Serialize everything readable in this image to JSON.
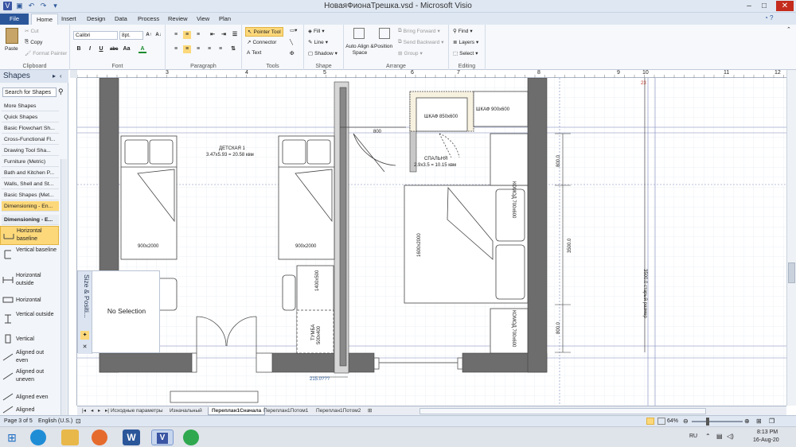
{
  "window": {
    "title": "НоваяФионаТрешка.vsd  -  Microsoft Visio"
  },
  "tabs": [
    "File",
    "Home",
    "Insert",
    "Design",
    "Data",
    "Process",
    "Review",
    "View",
    "Plan"
  ],
  "ribbon": {
    "clipboard": {
      "paste": "Paste",
      "cut": "Cut",
      "copy": "Copy",
      "format_painter": "Format Painter",
      "label": "Clipboard"
    },
    "font": {
      "family": "Calibri",
      "size": "8pt.",
      "label": "Font",
      "bold": "B",
      "italic": "I",
      "underline": "U",
      "abc": "abc",
      "aa": "Aa"
    },
    "paragraph": {
      "label": "Paragraph"
    },
    "tools": {
      "pointer": "Pointer Tool",
      "connector": "Connector",
      "text": "Text",
      "label": "Tools"
    },
    "shape": {
      "fill": "Fill",
      "line": "Line",
      "shadow": "Shadow",
      "label": "Shape"
    },
    "arrange": {
      "auto_align": "Auto Align & Space",
      "position": "Position",
      "bring_forward": "Bring Forward",
      "send_backward": "Send Backward",
      "group": "Group",
      "label": "Arrange"
    },
    "editing": {
      "find": "Find",
      "layers": "Layers",
      "select": "Select",
      "label": "Editing"
    }
  },
  "shapes_panel": {
    "title": "Shapes",
    "search_placeholder": "Search for Shapes",
    "stencils": [
      "More Shapes",
      "Quick Shapes",
      "Basic Flowchart Sh...",
      "Cross-Functional Fl...",
      "Drawing Tool Sha...",
      "Furniture (Metric)",
      "Bath and Kitchen P...",
      "Walls, Shell and St...",
      "Basic Shapes (Met...",
      "Dimensioning - En..."
    ],
    "open_stencil": "Dimensioning - E...",
    "masters": [
      "Horizontal baseline",
      "Vertical baseline",
      "Horizontal outside",
      "Horizontal",
      "Vertical outside",
      "Vertical",
      "Aligned out even",
      "Aligned out uneven",
      "Aligned even",
      "Aligned"
    ]
  },
  "size_position": {
    "title": "Size & Positi...",
    "message": "No Selection"
  },
  "drawing": {
    "ruler_numbers": [
      "3",
      "4",
      "5",
      "6",
      "7",
      "8",
      "9",
      "10",
      "11",
      "12"
    ],
    "labels": {
      "room1": "ДЕТСКАЯ 1",
      "room1_area": "3.47х5.93 = 20.58 квм",
      "bed1": "900х2000",
      "bed2": "900х2000",
      "door_w": "800",
      "wardrobe1": "ШКАФ 850х600",
      "wardrobe2": "ШКАФ 900х600",
      "bedroom": "СПАЛЬНЯ",
      "bedroom_area": "2.9х3.5 = 10.15 квм",
      "dbl_bed": "1600х2000",
      "dresser1": "КОМОД 700х600",
      "dresser2": "КОМОД 700х600",
      "dim_800a": "800.0",
      "dim_3500": "3500.0",
      "dim_800b": "800.0",
      "dim_3500old": "3500.0 старый размер",
      "tumba": "ТУМБА",
      "tumba_size": "500х400",
      "side": "1400х500",
      "bottom_dim": "215.0???",
      "top_dim": "23"
    }
  },
  "page_tabs": [
    "Исходные параметры",
    "Изначальный",
    "Переплан1Сначала",
    "Переплан1Потом1",
    "Переплан1Потом2"
  ],
  "active_page": "Переплан1Сначала",
  "status": {
    "page": "Page 3 of 5",
    "language": "English (U.S.)",
    "zoom": "64%"
  },
  "taskbar": {
    "lang": "RU",
    "time": "8:13 PM",
    "date": "16-Aug-20"
  }
}
